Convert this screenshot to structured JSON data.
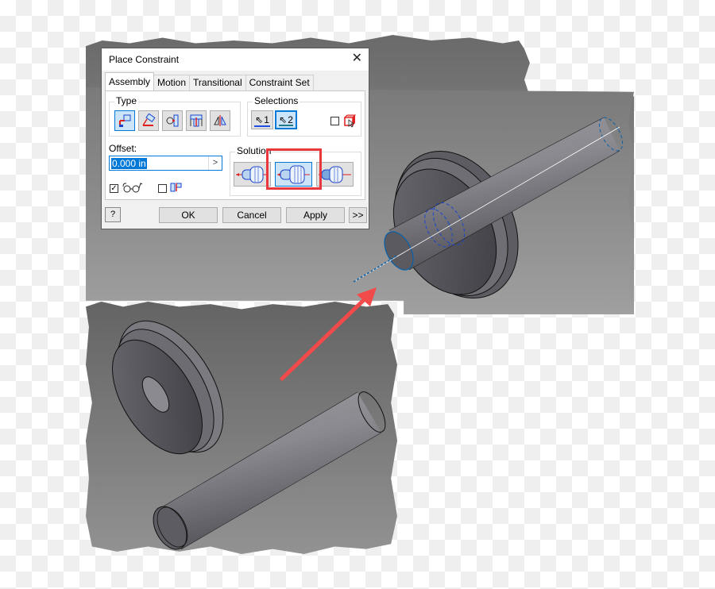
{
  "dialog": {
    "title": "Place Constraint",
    "close_icon": "close-icon",
    "tabs": [
      {
        "label": "Assembly",
        "active": true
      },
      {
        "label": "Motion",
        "active": false
      },
      {
        "label": "Transitional",
        "active": false
      },
      {
        "label": "Constraint Set",
        "active": false
      }
    ],
    "type_group": {
      "label": "Type",
      "buttons": [
        {
          "icon": "mate-constraint-icon",
          "selected": true
        },
        {
          "icon": "angle-constraint-icon",
          "selected": false
        },
        {
          "icon": "tangent-constraint-icon",
          "selected": false
        },
        {
          "icon": "insert-constraint-icon",
          "selected": false
        },
        {
          "icon": "symmetry-constraint-icon",
          "selected": false
        }
      ]
    },
    "selections_group": {
      "label": "Selections",
      "buttons": [
        {
          "label": "1",
          "icon": "cursor-arrow-icon",
          "selected": false,
          "color": "#1f4fe0"
        },
        {
          "label": "2",
          "icon": "cursor-arrow-icon",
          "selected": true,
          "color": "#1f7a8c"
        }
      ],
      "pick_part_first_checked": false,
      "pick_part_icon": "pick-part-first-icon"
    },
    "offset": {
      "label": "Offset:",
      "value": "0.000 in",
      "menu_arrow": ">"
    },
    "solution_group": {
      "label": "Solution",
      "buttons": [
        {
          "icon": "mate-solution-icon",
          "selected": false
        },
        {
          "icon": "flush-solution-icon",
          "selected": true
        },
        {
          "icon": "undirected-solution-icon",
          "selected": false
        }
      ]
    },
    "show_preview_checked": true,
    "show_preview_icon": "glasses-preview-icon",
    "predict_offset_checked": false,
    "predict_offset_icon": "predict-offset-icon",
    "buttons": {
      "help_icon": "help-icon",
      "ok": "OK",
      "cancel": "Cancel",
      "apply": "Apply",
      "more": ">>"
    }
  },
  "annotation": {
    "highlight_color": "#e8383d",
    "arrow_color": "#f24a4a"
  },
  "colors": {
    "accent": "#0078d7",
    "constraint_preview": "#1a5fcc"
  }
}
